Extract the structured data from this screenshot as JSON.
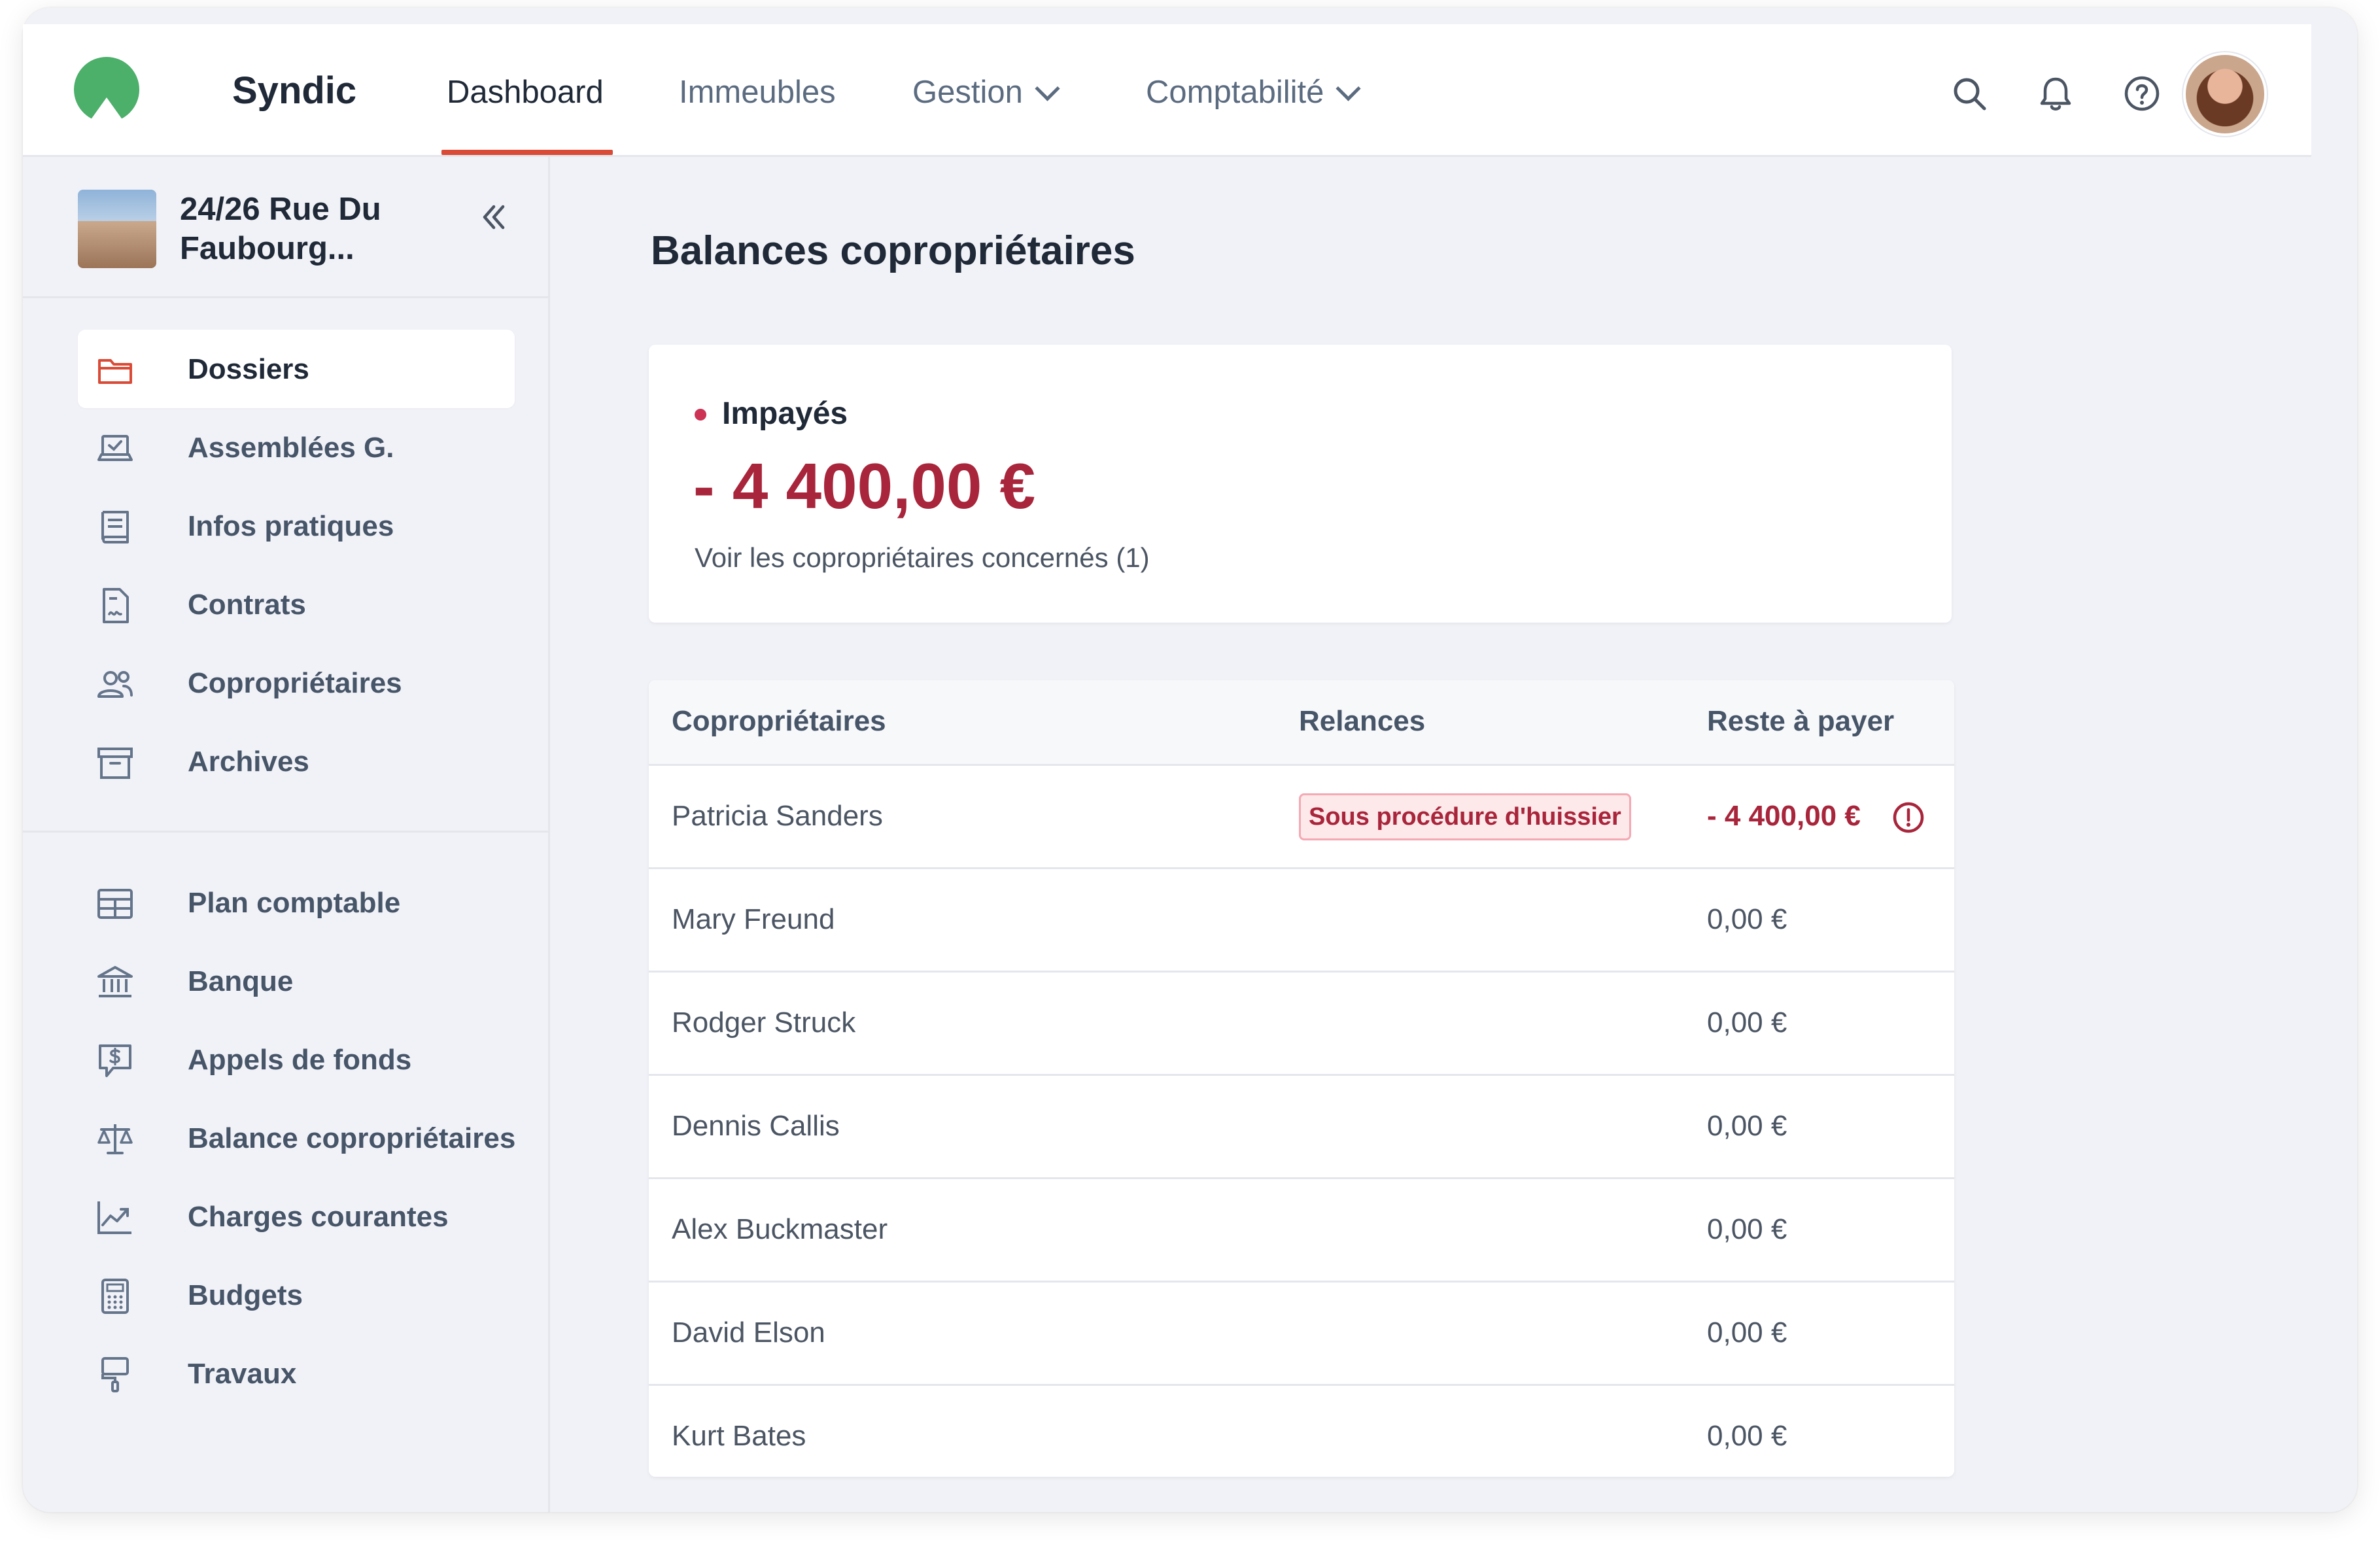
{
  "header": {
    "brand": "Syndic",
    "nav": [
      {
        "label": "Dashboard"
      },
      {
        "label": "Immeubles"
      },
      {
        "label": "Gestion"
      },
      {
        "label": "Comptabilité"
      }
    ],
    "icons": [
      "search-icon",
      "bell-icon",
      "help-icon"
    ]
  },
  "sidebar": {
    "building": "24/26 Rue Du Faubourg...",
    "group1": [
      {
        "label": "Dossiers",
        "icon": "folder-icon"
      },
      {
        "label": "Assemblées G.",
        "icon": "laptop-check-icon"
      },
      {
        "label": "Infos pratiques",
        "icon": "book-icon"
      },
      {
        "label": "Contrats",
        "icon": "contract-icon"
      },
      {
        "label": "Copropriétaires",
        "icon": "users-icon"
      },
      {
        "label": "Archives",
        "icon": "archive-icon"
      }
    ],
    "group2": [
      {
        "label": "Plan comptable",
        "icon": "table-icon"
      },
      {
        "label": "Banque",
        "icon": "bank-icon"
      },
      {
        "label": "Appels de fonds",
        "icon": "dollar-message-icon"
      },
      {
        "label": "Balance copropriétaires",
        "icon": "scale-icon"
      },
      {
        "label": "Charges courantes",
        "icon": "trend-chart-icon"
      },
      {
        "label": "Budgets",
        "icon": "calculator-icon"
      },
      {
        "label": "Travaux",
        "icon": "paint-roller-icon"
      }
    ]
  },
  "main": {
    "title": "Balances copropriétaires",
    "summary": {
      "label": "Impayés",
      "amount": "- 4 400,00 €",
      "link": "Voir les copropriétaires concernés (1)"
    },
    "table": {
      "columns": [
        "Copropriétaires",
        "Relances",
        "Reste à payer"
      ],
      "rows": [
        {
          "name": "Patricia Sanders",
          "relance": "Sous procédure d'huissier",
          "reste": "- 4 400,00 €"
        },
        {
          "name": "Mary Freund",
          "relance": "",
          "reste": "0,00 €"
        },
        {
          "name": "Rodger Struck",
          "relance": "",
          "reste": "0,00 €"
        },
        {
          "name": "Dennis Callis",
          "relance": "",
          "reste": "0,00 €"
        },
        {
          "name": "Alex Buckmaster",
          "relance": "",
          "reste": "0,00 €"
        },
        {
          "name": "David Elson",
          "relance": "",
          "reste": "0,00 €"
        },
        {
          "name": "Kurt Bates",
          "relance": "",
          "reste": "0,00 €"
        }
      ]
    }
  },
  "colors": {
    "accent": "#d94b36",
    "negative": "#a8253b",
    "logo_green": "#4caf6a"
  }
}
